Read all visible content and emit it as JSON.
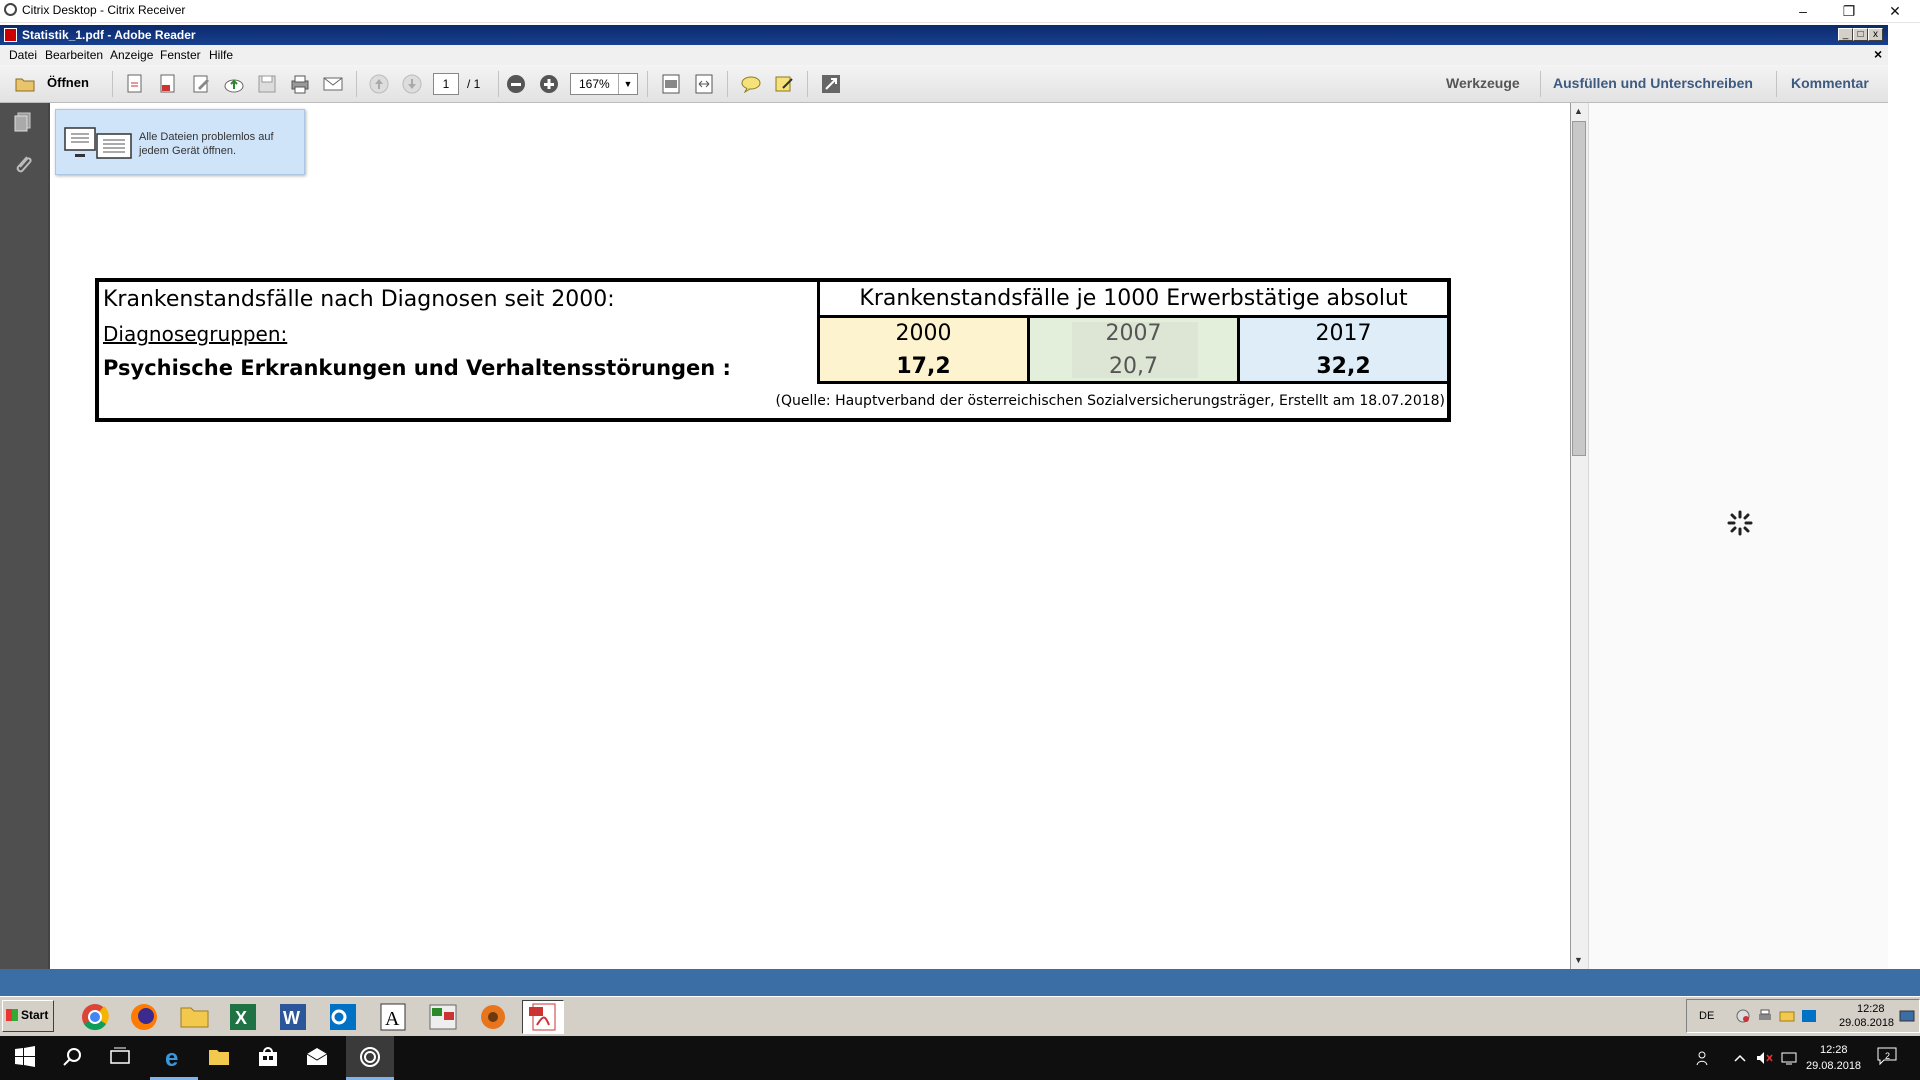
{
  "citrix": {
    "title": "Citrix Desktop - Citrix Receiver",
    "minimize": "–",
    "restore": "❐",
    "close": "✕"
  },
  "adobe": {
    "title": "Statistik_1.pdf - Adobe Reader",
    "doc_close": "×"
  },
  "menu": {
    "items": [
      "Datei",
      "Bearbeiten",
      "Anzeige",
      "Fenster",
      "Hilfe"
    ]
  },
  "toolbar": {
    "open_label": "Öffnen",
    "page_current": "1",
    "page_total": "/ 1",
    "zoom": "167%",
    "tools_label": "Werkzeuge",
    "fill_sign_label": "Ausfüllen und Unterschreiben",
    "comment_label": "Kommentar"
  },
  "tooltip": {
    "line1": "Alle Dateien problemlos auf",
    "line2": "jedem Gerät öffnen."
  },
  "document": {
    "heading": "Krankenstandsfälle nach Diagnosen seit 2000:",
    "column_header": "Krankenstandsfälle je 1000 Erwerbstätige absolut",
    "group_label": "Diagnosegruppen:",
    "row_label": "Psychische Erkrankungen und Verhaltensstörungen :",
    "years": [
      "2000",
      "2007",
      "2017"
    ],
    "values": [
      "17,2",
      "20,7",
      "32,2"
    ],
    "source": "(Quelle: Hauptverband der österreichischen Sozialversicherungsträger, Erstellt am 18.07.2018)",
    "colors": {
      "year_2000": "#fdf3cf",
      "year_2007": "#e3eedb",
      "year_2017": "#deedf7"
    }
  },
  "citrix_taskbar": {
    "start_label": "Start",
    "lang": "DE",
    "time": "12:28",
    "date": "29.08.2018"
  },
  "win10_taskbar": {
    "time": "12:28",
    "date": "29.08.2018",
    "notification_count": "2"
  }
}
